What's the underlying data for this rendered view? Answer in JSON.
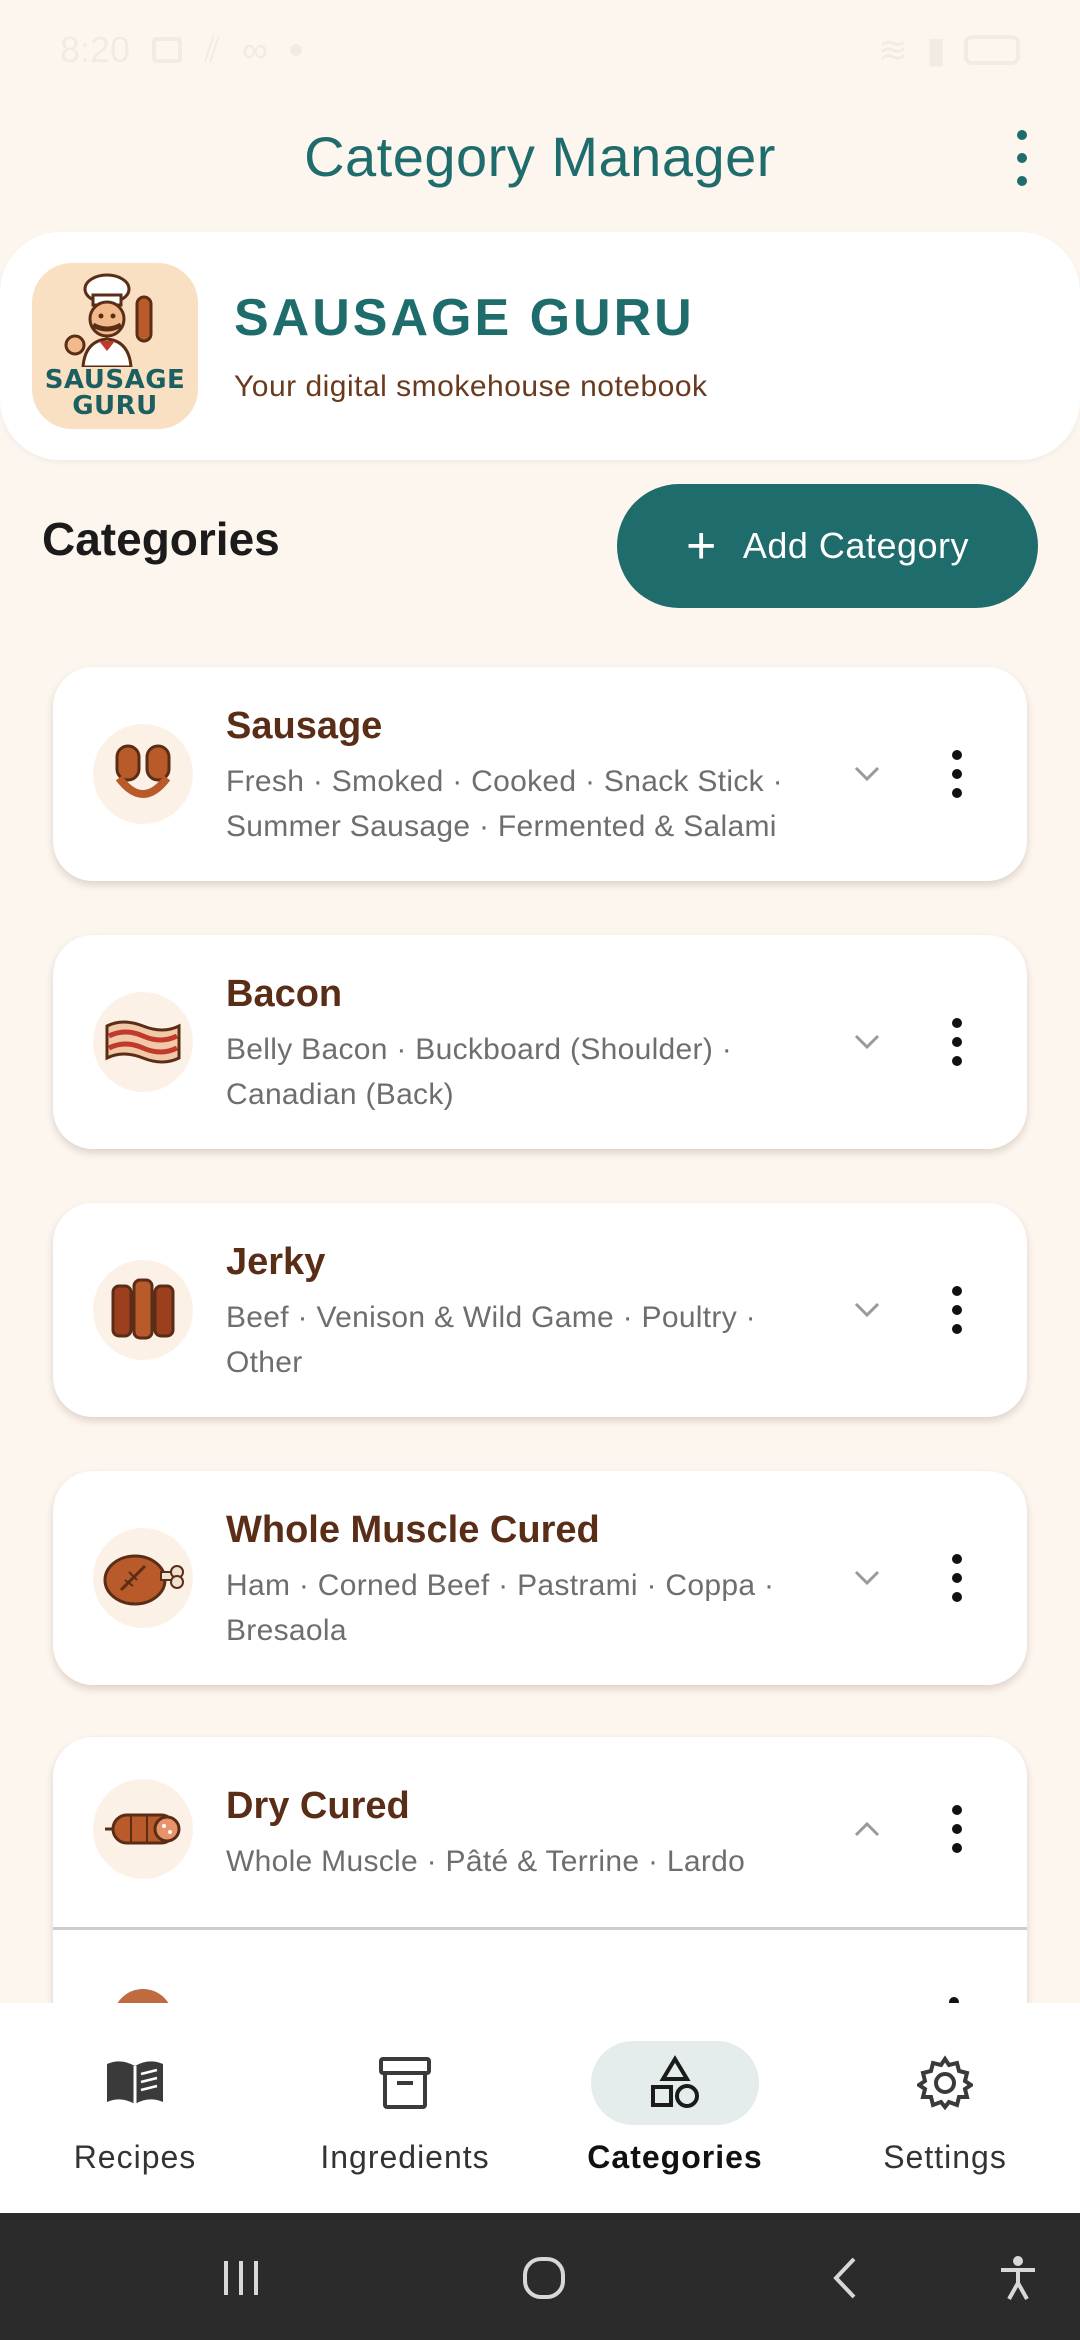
{
  "status_bar": {
    "time": "8:20"
  },
  "app_bar": {
    "title": "Category Manager"
  },
  "brand": {
    "logo_line1": "SAUSAGE",
    "logo_line2": "GURU",
    "title": "SAUSAGE GURU",
    "subtitle": "Your digital smokehouse notebook"
  },
  "section": {
    "title": "Categories",
    "add_label": "Add Category"
  },
  "categories": [
    {
      "name": "Sausage",
      "subs_line1": "Fresh · Smoked · Cooked · Snack Stick ·",
      "subs_line2": "Summer Sausage · Fermented & Salami",
      "icon": "sausage-icon",
      "expanded": false
    },
    {
      "name": "Bacon",
      "subs_line1": "Belly Bacon · Buckboard (Shoulder) ·",
      "subs_line2": "Canadian (Back)",
      "icon": "bacon-icon",
      "expanded": false
    },
    {
      "name": "Jerky",
      "subs_line1": "Beef · Venison & Wild Game · Poultry ·",
      "subs_line2": "Other",
      "icon": "jerky-icon",
      "expanded": false
    },
    {
      "name": "Whole Muscle Cured",
      "subs_line1": "Ham · Corned Beef · Pastrami · Coppa ·",
      "subs_line2": "Bresaola",
      "icon": "ham-icon",
      "expanded": false
    },
    {
      "name": "Dry Cured",
      "subs_line1": "Whole Muscle · Pâté & Terrine · Lardo",
      "subs_line2": "",
      "icon": "salami-icon",
      "expanded": true
    }
  ],
  "bottom_nav": [
    {
      "label": "Recipes",
      "icon": "book-icon",
      "active": false
    },
    {
      "label": "Ingredients",
      "icon": "archive-box-icon",
      "active": false
    },
    {
      "label": "Categories",
      "icon": "shapes-icon",
      "active": true
    },
    {
      "label": "Settings",
      "icon": "gear-icon",
      "active": false
    }
  ],
  "colors": {
    "primary": "#1f6c6c",
    "brown_text": "#5a2d17",
    "background": "#fdf6ef"
  }
}
